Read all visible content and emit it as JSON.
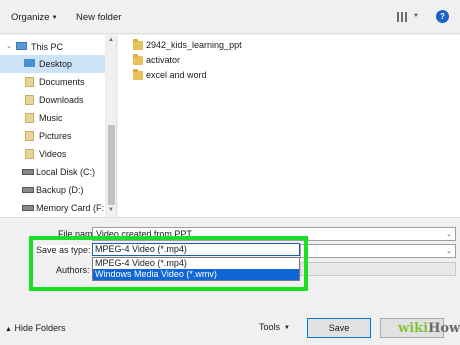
{
  "toolbar": {
    "organize_label": "Organize",
    "new_folder_label": "New folder",
    "help_label": "?"
  },
  "nav": {
    "items": [
      {
        "label": "This PC",
        "icon": "pc-icon"
      },
      {
        "label": "Desktop",
        "icon": "desktop-icon",
        "selected": true
      },
      {
        "label": "Documents",
        "icon": "documents-icon"
      },
      {
        "label": "Downloads",
        "icon": "downloads-icon"
      },
      {
        "label": "Music",
        "icon": "music-icon"
      },
      {
        "label": "Pictures",
        "icon": "pictures-icon"
      },
      {
        "label": "Videos",
        "icon": "videos-icon"
      },
      {
        "label": "Local Disk (C:)",
        "icon": "disk-icon"
      },
      {
        "label": "Backup (D:)",
        "icon": "disk-icon"
      },
      {
        "label": "Memory Card (F:",
        "icon": "disk-icon"
      }
    ]
  },
  "files": {
    "items": [
      {
        "label": "2942_kids_learning_ppt"
      },
      {
        "label": "activator"
      },
      {
        "label": "excel and word"
      }
    ]
  },
  "form": {
    "file_name_label": "File name:",
    "file_name_value": "Video created from PPT",
    "save_as_type_label": "Save as type:",
    "save_as_type_value": "MPEG-4 Video (*.mp4)",
    "authors_label": "Authors:",
    "type_options": [
      {
        "label": "MPEG-4 Video (*.mp4)"
      },
      {
        "label": "Windows Media Video (*.wmv)",
        "selected": true
      }
    ]
  },
  "footer": {
    "hide_folders_label": "Hide Folders",
    "tools_label": "Tools",
    "save_label": "Save"
  },
  "watermark": {
    "part1": "wiki",
    "part2": "How"
  },
  "colors": {
    "highlight": "#19e024",
    "selection": "#0f66d6",
    "nav_selected": "#cce3f8"
  }
}
